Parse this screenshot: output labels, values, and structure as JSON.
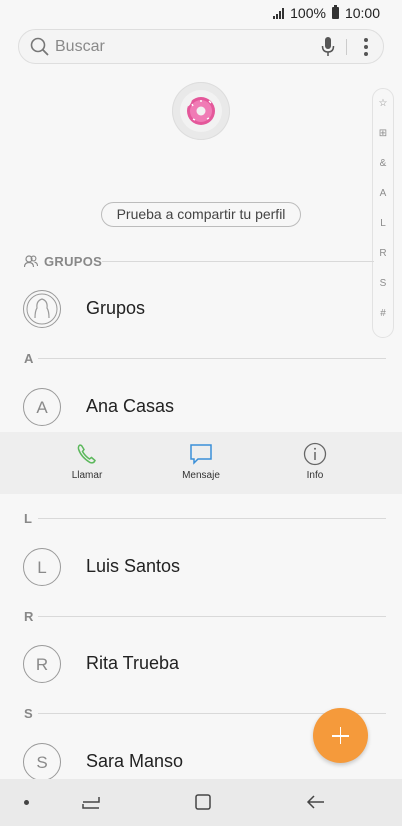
{
  "status_bar": {
    "battery_text": "100%",
    "time": "10:00"
  },
  "search": {
    "placeholder": "Buscar"
  },
  "profile": {
    "share_label": "Prueba a compartir tu perfil"
  },
  "index_bar": [
    "☆",
    "⊞",
    "&",
    "A",
    "L",
    "R",
    "S",
    "#"
  ],
  "groups": {
    "section_label": "GRUPOS",
    "item_label": "Grupos"
  },
  "sections": [
    {
      "letter": "A",
      "contacts": [
        {
          "initial": "A",
          "name": "Ana Casas"
        }
      ]
    },
    {
      "letter": "L",
      "contacts": [
        {
          "initial": "L",
          "name": "Luis Santos"
        }
      ]
    },
    {
      "letter": "R",
      "contacts": [
        {
          "initial": "R",
          "name": "Rita Trueba"
        }
      ]
    },
    {
      "letter": "S",
      "contacts": [
        {
          "initial": "S",
          "name": "Sara Manso"
        }
      ]
    }
  ],
  "actions": {
    "call": "Llamar",
    "message": "Mensaje",
    "info": "Info"
  },
  "colors": {
    "accent_fab": "#f59a3b",
    "call_green": "#5cb85c",
    "message_blue": "#3a8fd8"
  }
}
